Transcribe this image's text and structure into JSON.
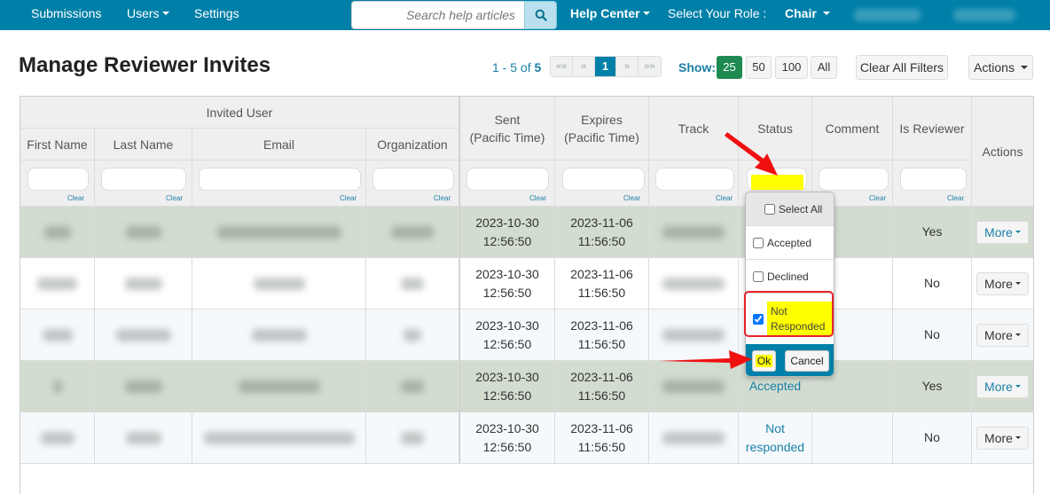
{
  "navbar": {
    "items": [
      {
        "label": "Submissions"
      },
      {
        "label": "Users",
        "has_caret": true
      },
      {
        "label": "Settings"
      }
    ],
    "search": {
      "placeholder": "Search help articles",
      "icon": "search-icon"
    },
    "help_center": "Help Center",
    "role_label": "Select Your Role :",
    "role_value": "Chair"
  },
  "page": {
    "title": "Manage Reviewer Invites"
  },
  "toolbar": {
    "range": "1 - 5 of ",
    "total": "5",
    "pager": [
      "««",
      "«",
      "1",
      "»",
      "»»"
    ],
    "current_page": "1",
    "show_label": "Show:",
    "show_options": [
      "25",
      "50",
      "100",
      "All"
    ],
    "show_selected": "25",
    "clear_filters": "Clear All Filters",
    "actions": "Actions"
  },
  "table": {
    "group_header": "Invited User",
    "columns": [
      {
        "key": "first_name",
        "label": "First Name"
      },
      {
        "key": "last_name",
        "label": "Last Name"
      },
      {
        "key": "email",
        "label": "Email"
      },
      {
        "key": "organization",
        "label": "Organization"
      },
      {
        "key": "sent",
        "label": "Sent",
        "sublabel": "(Pacific Time)"
      },
      {
        "key": "expires",
        "label": "Expires",
        "sublabel": "(Pacific Time)"
      },
      {
        "key": "track",
        "label": "Track"
      },
      {
        "key": "status",
        "label": "Status"
      },
      {
        "key": "comment",
        "label": "Comment"
      },
      {
        "key": "is_reviewer",
        "label": "Is Reviewer"
      },
      {
        "key": "actions",
        "label": "Actions"
      }
    ],
    "clear_label": "Clear",
    "rows": [
      {
        "style": "green",
        "sent": [
          "2023-10-30",
          "12:56:50"
        ],
        "expires": [
          "2023-11-06",
          "11:56:50"
        ],
        "status": "",
        "is_reviewer": "Yes",
        "more": "More"
      },
      {
        "style": "white",
        "sent": [
          "2023-10-30",
          "12:56:50"
        ],
        "expires": [
          "2023-11-06",
          "11:56:50"
        ],
        "status": "",
        "is_reviewer": "No",
        "more": "More"
      },
      {
        "style": "blue",
        "sent": [
          "2023-10-30",
          "12:56:50"
        ],
        "expires": [
          "2023-11-06",
          "11:56:50"
        ],
        "status": "",
        "is_reviewer": "No",
        "more": "More"
      },
      {
        "style": "green",
        "sent": [
          "2023-10-30",
          "12:56:50"
        ],
        "expires": [
          "2023-11-06",
          "11:56:50"
        ],
        "status": "Accepted",
        "is_reviewer": "Yes",
        "more": "More"
      },
      {
        "style": "blue",
        "sent": [
          "2023-10-30",
          "12:56:50"
        ],
        "expires": [
          "2023-11-06",
          "11:56:50"
        ],
        "status": "Not responded",
        "is_reviewer": "No",
        "more": "More"
      }
    ]
  },
  "status_filter": {
    "select_all": "Select All",
    "options": [
      {
        "label": "Accepted",
        "checked": false
      },
      {
        "label": "Declined",
        "checked": false
      },
      {
        "label": "Not Responded",
        "checked": true
      }
    ],
    "ok": "Ok",
    "cancel": "Cancel"
  },
  "colors": {
    "brand": "#0080a8",
    "show_active": "#1e8a52",
    "highlight": "#ffff00",
    "annotation_red": "#e8222a",
    "row_green": "#d2dccf"
  }
}
